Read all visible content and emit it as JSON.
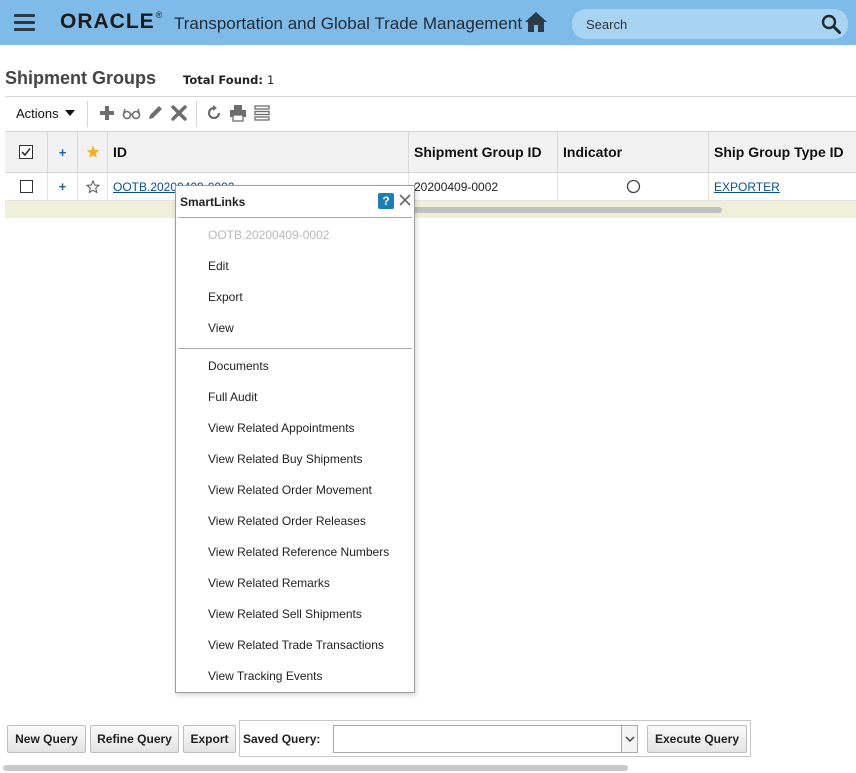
{
  "header": {
    "logo": "ORACLE",
    "logo_mark": "®",
    "app_title": "Transportation and Global Trade Management",
    "search_placeholder": "Search"
  },
  "page": {
    "title": "Shipment Groups",
    "total_label": "Total Found:",
    "total_value": "1"
  },
  "toolbar": {
    "actions_label": "Actions",
    "icons": [
      "add-icon",
      "view-icon",
      "edit-icon",
      "delete-icon",
      "refresh-icon",
      "print-icon",
      "columns-icon"
    ]
  },
  "table": {
    "columns": [
      "ID",
      "Shipment Group ID",
      "Indicator",
      "Ship Group Type ID"
    ],
    "rows": [
      {
        "id": "OOTB.20200409-0002",
        "shipment_group_id": "20200409-0002",
        "indicator": "empty-circle",
        "ship_group_type_id": "EXPORTER"
      }
    ]
  },
  "smartlinks": {
    "title": "SmartLinks",
    "context_item": "OOTB.20200409-0002",
    "items": [
      "Edit",
      "Export",
      "View"
    ],
    "related_items": [
      "Documents",
      "Full Audit",
      "View Related Appointments",
      "View Related Buy Shipments",
      "View Related Order Movement",
      "View Related Order Releases",
      "View Related Reference Numbers",
      "View Related Remarks",
      "View Related Sell Shipments",
      "View Related Trade Transactions",
      "View Tracking Events"
    ]
  },
  "bottom": {
    "new_query": "New Query",
    "refine_query": "Refine Query",
    "export": "Export",
    "saved_query_label": "Saved Query:",
    "saved_query_value": "",
    "execute_query": "Execute Query"
  },
  "colors": {
    "header_bg": "#7fbbe8",
    "search_bg": "#a9d3f2",
    "link": "#0b4f8f",
    "star": "#f2b01e",
    "help_icon": "#1a7fb5"
  }
}
